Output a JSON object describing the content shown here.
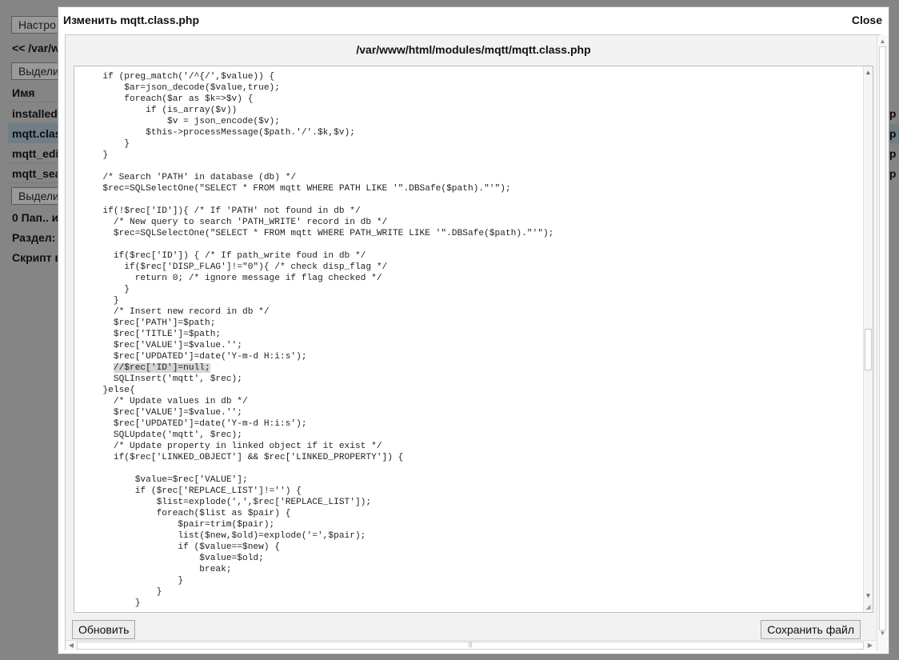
{
  "background": {
    "buttons": [
      "Настро",
      "Выдели",
      "Выдели"
    ],
    "path_link": "<< /var/w",
    "header": "Имя",
    "files": [
      "installed",
      "mqtt.clas",
      "mqtt_edi",
      "mqtt_sea"
    ],
    "right_fragments": [
      "гр",
      "гр",
      "гр",
      "гр"
    ],
    "info_lines": [
      "0 Пап.. и",
      "Раздел:",
      "Скрипт в"
    ]
  },
  "dialog": {
    "title": "Изменить mqtt.class.php",
    "close_label": "Close",
    "file_path": "/var/www/html/modules/mqtt/mqtt.class.php",
    "refresh_label": "Обновить",
    "save_label": "Сохранить файл"
  },
  "code": {
    "before_highlight": "  if (preg_match('/^{/',$value)) {\n      $ar=json_decode($value,true);\n      foreach($ar as $k=>$v) {\n          if (is_array($v))\n              $v = json_encode($v);\n          $this->processMessage($path.'/'.$k,$v);\n      }\n  }\n\n  /* Search 'PATH' in database (db) */\n  $rec=SQLSelectOne(\"SELECT * FROM mqtt WHERE PATH LIKE '\".DBSafe($path).\"'\");\n\n  if(!$rec['ID']){ /* If 'PATH' not found in db */\n    /* New query to search 'PATH_WRITE' record in db */\n    $rec=SQLSelectOne(\"SELECT * FROM mqtt WHERE PATH_WRITE LIKE '\".DBSafe($path).\"'\");\n\n    if($rec['ID']) { /* If path_write foud in db */\n      if($rec['DISP_FLAG']!=\"0\"){ /* check disp_flag */\n        return 0; /* ignore message if flag checked */\n      }\n    }\n    /* Insert new record in db */\n    $rec['PATH']=$path;\n    $rec['TITLE']=$path;\n    $rec['VALUE']=$value.'';\n    $rec['UPDATED']=date('Y-m-d H:i:s');\n    ",
    "highlight": "//$rec['ID']=null;",
    "after_highlight": "\n    SQLInsert('mqtt', $rec);\n  }else{\n    /* Update values in db */\n    $rec['VALUE']=$value.'';\n    $rec['UPDATED']=date('Y-m-d H:i:s');\n    SQLUpdate('mqtt', $rec);\n    /* Update property in linked object if it exist */\n    if($rec['LINKED_OBJECT'] && $rec['LINKED_PROPERTY']) {\n\n        $value=$rec['VALUE'];\n        if ($rec['REPLACE_LIST']!='') {\n            $list=explode(',',$rec['REPLACE_LIST']);\n            foreach($list as $pair) {\n                $pair=trim($pair);\n                list($new,$old)=explode('=',$pair);\n                if ($value==$new) {\n                    $value=$old;\n                    break;\n                }\n            }\n        }"
  },
  "icons": {
    "scroll_up": "scroll-up-icon",
    "scroll_down": "scroll-down-icon",
    "scroll_left": "scroll-left-icon",
    "scroll_right": "scroll-right-icon",
    "resize_grip": "resize-grip-icon"
  }
}
